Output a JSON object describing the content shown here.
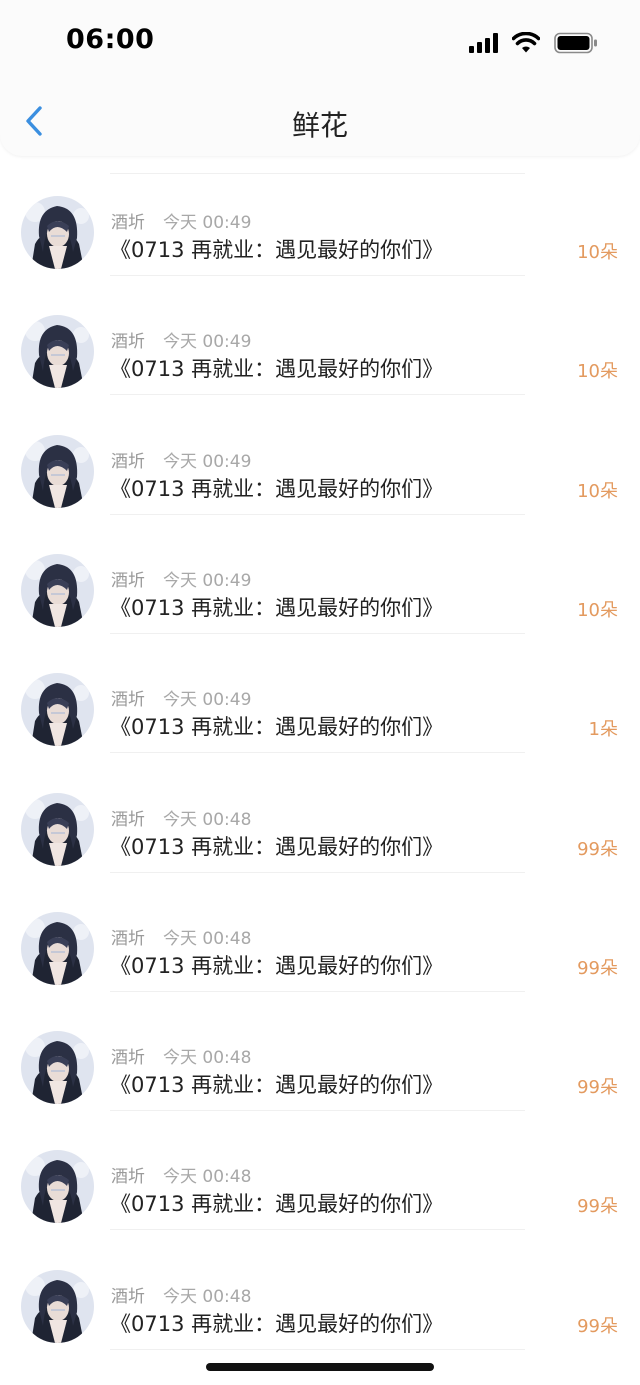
{
  "status_bar": {
    "time": "06:00",
    "icons": [
      "signal-icon",
      "wifi-icon",
      "battery-icon"
    ]
  },
  "nav": {
    "title": "鲜花",
    "back_icon": "chevron-left-icon",
    "accent_color": "#3b8fe0"
  },
  "colors": {
    "amount": "#e39a5f",
    "meta": "#9a9a9a",
    "message": "#222222"
  },
  "items": [
    {
      "user": "酒圻",
      "time": "今天 00:49",
      "message": "《0713 再就业：遇见最好的你们》",
      "amount": "10朵"
    },
    {
      "user": "酒圻",
      "time": "今天 00:49",
      "message": "《0713 再就业：遇见最好的你们》",
      "amount": "10朵"
    },
    {
      "user": "酒圻",
      "time": "今天 00:49",
      "message": "《0713 再就业：遇见最好的你们》",
      "amount": "10朵"
    },
    {
      "user": "酒圻",
      "time": "今天 00:49",
      "message": "《0713 再就业：遇见最好的你们》",
      "amount": "10朵"
    },
    {
      "user": "酒圻",
      "time": "今天 00:49",
      "message": "《0713 再就业：遇见最好的你们》",
      "amount": "1朵"
    },
    {
      "user": "酒圻",
      "time": "今天 00:48",
      "message": "《0713 再就业：遇见最好的你们》",
      "amount": "99朵"
    },
    {
      "user": "酒圻",
      "time": "今天 00:48",
      "message": "《0713 再就业：遇见最好的你们》",
      "amount": "99朵"
    },
    {
      "user": "酒圻",
      "time": "今天 00:48",
      "message": "《0713 再就业：遇见最好的你们》",
      "amount": "99朵"
    },
    {
      "user": "酒圻",
      "time": "今天 00:48",
      "message": "《0713 再就业：遇见最好的你们》",
      "amount": "99朵"
    },
    {
      "user": "酒圻",
      "time": "今天 00:48",
      "message": "《0713 再就业：遇见最好的你们》",
      "amount": "99朵"
    }
  ]
}
